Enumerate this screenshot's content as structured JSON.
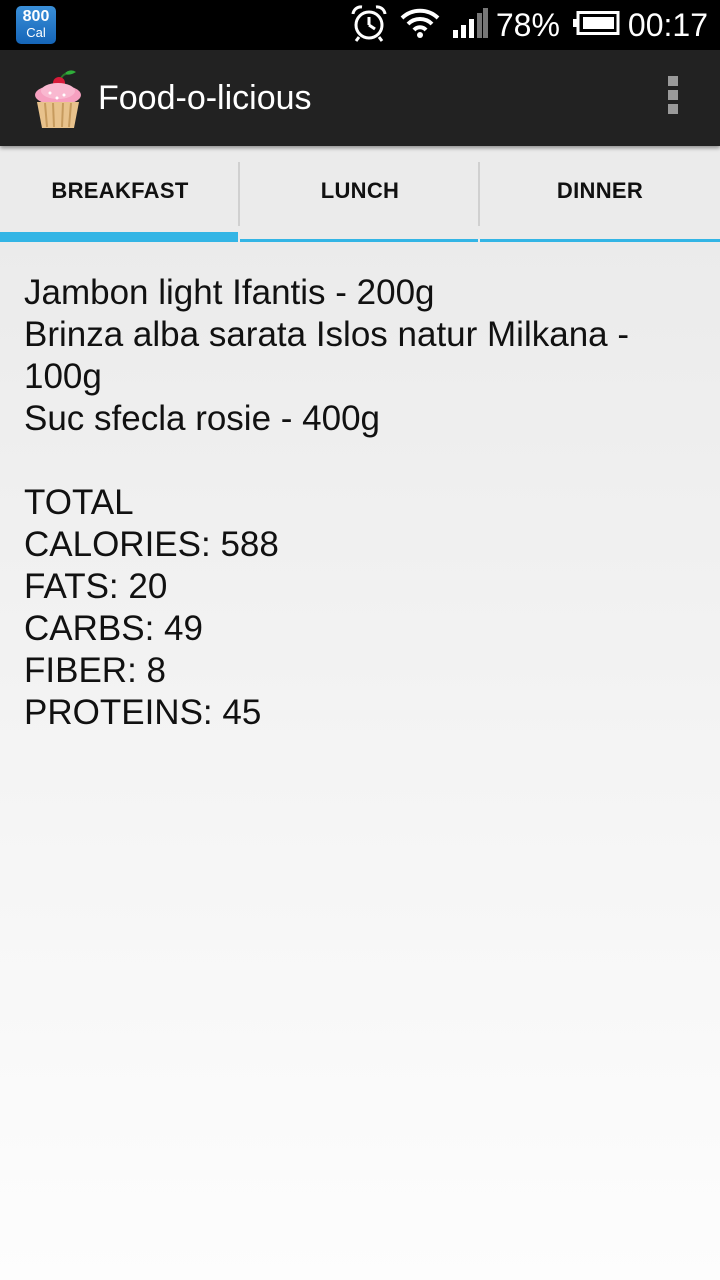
{
  "status_bar": {
    "notification": {
      "value": "800",
      "unit": "Cal"
    },
    "battery_percent": "78%",
    "time": "00:17",
    "icons": [
      "alarm-icon",
      "wifi-icon",
      "signal-icon",
      "battery-icon"
    ]
  },
  "action_bar": {
    "app_icon": "cupcake-icon",
    "title": "Food-o-licious",
    "overflow_icon": "overflow-menu-icon"
  },
  "tabs": [
    {
      "label": "BREAKFAST",
      "selected": true
    },
    {
      "label": "LUNCH",
      "selected": false
    },
    {
      "label": "DINNER",
      "selected": false
    }
  ],
  "meal": {
    "items": [
      "Jambon light Ifantis - 200g",
      "Brinza alba sarata Islos natur Milkana - 100g",
      "Suc sfecla rosie - 400g"
    ],
    "totals": {
      "heading": "TOTAL",
      "calories": "CALORIES: 588",
      "fats": "FATS: 20",
      "carbs": "CARBS: 49",
      "fiber": "FIBER: 8",
      "proteins": "PROTEINS: 45"
    }
  },
  "colors": {
    "accent": "#33b5e5",
    "action_bar": "#222222",
    "status_bar": "#000000"
  }
}
